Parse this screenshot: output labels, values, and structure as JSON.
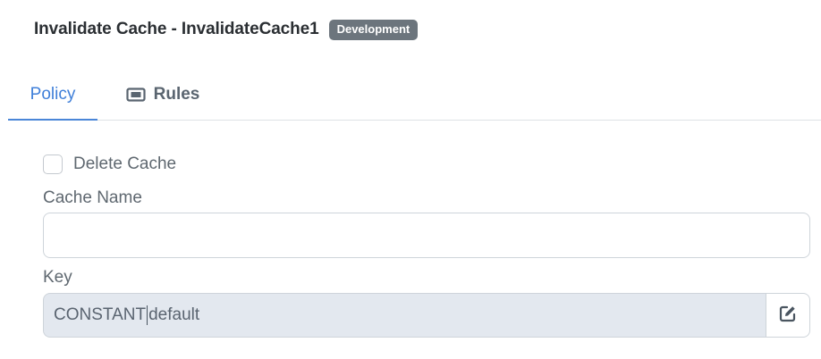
{
  "header": {
    "title": "Invalidate Cache - InvalidateCache1",
    "badge": "Development"
  },
  "tabs": [
    {
      "label": "Policy",
      "active": true
    },
    {
      "label": "Rules",
      "icon": "ticket-icon",
      "active": false
    }
  ],
  "form": {
    "delete_cache": {
      "label": "Delete Cache",
      "checked": false
    },
    "cache_name": {
      "label": "Cache Name",
      "value": ""
    },
    "key": {
      "label": "Key",
      "value_before_cursor": "CONSTANT",
      "value_after_cursor": "default",
      "edit_icon": "edit-icon"
    }
  },
  "colors": {
    "accent": "#3f7fd9",
    "badge_bg": "#6c757d",
    "readonly_bg": "#e3e8ef"
  }
}
